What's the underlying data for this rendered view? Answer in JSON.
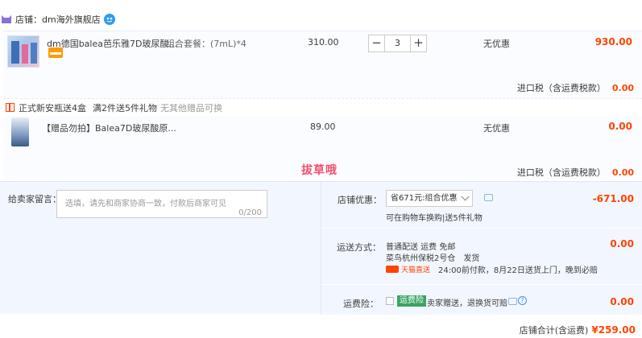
{
  "shop": {
    "label": "店铺：",
    "name": "dm海外旗舰店"
  },
  "item1": {
    "title": "dm德国balea芭乐雅7D玻尿酸...",
    "sku": "组合套餐：(7mL)*4",
    "price": "310.00",
    "quantity": "3",
    "qty_minus": "−",
    "qty_plus": "+",
    "promotion": "无优惠",
    "subtotal": "930.00",
    "tax_label": "进口税（含运费税款）",
    "tax_value": "0.00"
  },
  "gift": {
    "text1": "正式新安瓶送4盒",
    "text2": "满2件送5件礼物",
    "text3": "无其他赠品可换"
  },
  "item2": {
    "title": "【赠品勿拍】Balea7D玻尿酸原...",
    "price": "89.00",
    "promotion": "无优惠",
    "subtotal": "0.00",
    "tax_label": "进口税（含运费税款）",
    "tax_value": "0.00"
  },
  "watermark": "拔草哦",
  "message": {
    "label": "给卖家留言：",
    "placeholder": "选填，请先和商家协商一致，付款后商家可见",
    "count": "0/200"
  },
  "discount": {
    "label": "店铺优惠：",
    "selected": "省671元:组合优惠",
    "sub": "可在购物车换购|送5件礼物",
    "amount": "-671.00"
  },
  "shipping": {
    "label": "运送方式：",
    "line1": "普通配送 运费 免邮",
    "line2": "菜鸟杭州保税2号仓　发货",
    "tmall_label": "天猫直送",
    "line3": "24:00前付款，8月22日送货上门，晚到必赔",
    "amount": "0.00"
  },
  "insurance": {
    "label": "运费险：",
    "badge": "运费险",
    "text": "卖家赠送，退换货可赔",
    "help": "?",
    "amount": "0.00"
  },
  "total": {
    "label": "店铺合计(含运费)",
    "value": "¥259.00"
  },
  "colors": {
    "accent": "#ff4400",
    "panel_bg": "#f2f7ff",
    "insurance_badge": "#3aa561"
  }
}
